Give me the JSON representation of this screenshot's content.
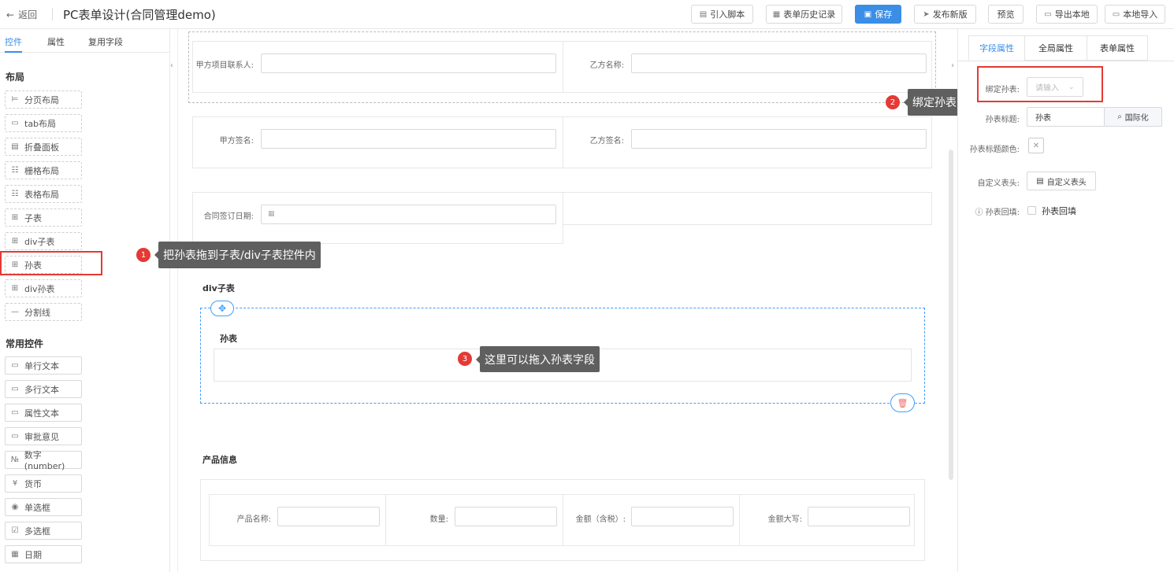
{
  "header": {
    "back_label": "返回",
    "title": "PC表单设计(合同管理demo)",
    "buttons": {
      "import_script": "引入脚本",
      "history": "表单历史记录",
      "save": "保存",
      "publish": "发布新版",
      "preview": "预览",
      "export_local": "导出本地",
      "import_local": "本地导入"
    }
  },
  "left": {
    "tabs": [
      "控件",
      "属性",
      "复用字段"
    ],
    "layout_title": "布局",
    "layout_items": [
      "分页布局",
      "tab布局",
      "折叠面板",
      "栅格布局",
      "表格布局",
      "子表",
      "div子表",
      "孙表",
      "div孙表",
      "分割线"
    ],
    "common_title": "常用控件",
    "common_items": [
      "单行文本",
      "多行文本",
      "属性文本",
      "审批意见",
      "数字(number)",
      "货币",
      "单选框",
      "多选框",
      "日期"
    ]
  },
  "canvas": {
    "fields": {
      "party_a_contact": "甲方项目联系人:",
      "party_b_name": "乙方名称:",
      "party_a_sign": "甲方签名:",
      "party_b_sign": "乙方签名:",
      "sign_date": "合同签订日期:"
    },
    "div_subtable_title": "div子表",
    "grand_table_title": "孙表",
    "product_section_title": "产品信息",
    "product_fields": {
      "name": "产品名称:",
      "qty": "数量:",
      "amount": "金额（含税）:",
      "amount_upper": "金额大写:"
    }
  },
  "callouts": [
    {
      "num": "1",
      "text": "把孙表拖到子表/div子表控件内"
    },
    {
      "num": "2",
      "text": "绑定孙表"
    },
    {
      "num": "3",
      "text": "这里可以拖入孙表字段"
    }
  ],
  "right": {
    "tabs": [
      "字段属性",
      "全局属性",
      "表单属性"
    ],
    "bind_label": "绑定孙表:",
    "bind_placeholder": "请输入",
    "title_label": "孙表标题:",
    "title_value": "孙表",
    "i18n_button": "国际化",
    "title_color_label": "孙表标题颜色:",
    "custom_header_label": "自定义表头:",
    "custom_header_button": "自定义表头",
    "backfill_label": "孙表回填:",
    "backfill_checkbox_label": "孙表回填"
  },
  "colors": {
    "accent": "#3a8ee6",
    "callout_red": "#e53935",
    "tooltip_bg": "#5f5f5f"
  }
}
